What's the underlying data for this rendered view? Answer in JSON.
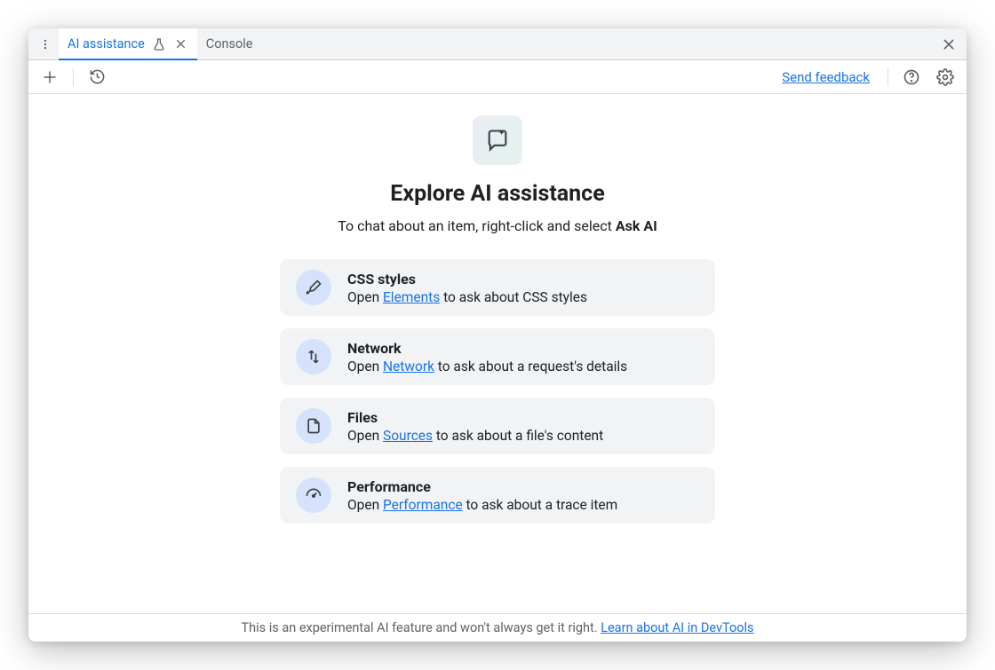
{
  "tabs": {
    "active": {
      "label": "AI assistance"
    },
    "other": {
      "label": "Console"
    }
  },
  "toolbar": {
    "feedback": "Send feedback"
  },
  "hero": {
    "title": "Explore AI assistance",
    "sub_prefix": "To chat about an item, right-click and select ",
    "sub_bold": "Ask AI"
  },
  "cards": [
    {
      "icon": "brush",
      "title": "CSS styles",
      "prefix": "Open ",
      "link": "Elements",
      "suffix": " to ask about CSS styles"
    },
    {
      "icon": "network",
      "title": "Network",
      "prefix": "Open ",
      "link": "Network",
      "suffix": " to ask about a request's details"
    },
    {
      "icon": "file",
      "title": "Files",
      "prefix": "Open ",
      "link": "Sources",
      "suffix": " to ask about a file's content"
    },
    {
      "icon": "gauge",
      "title": "Performance",
      "prefix": "Open ",
      "link": "Performance",
      "suffix": " to ask about a trace item"
    }
  ],
  "footer": {
    "text": "This is an experimental AI feature and won't always get it right. ",
    "link": "Learn about AI in DevTools"
  }
}
